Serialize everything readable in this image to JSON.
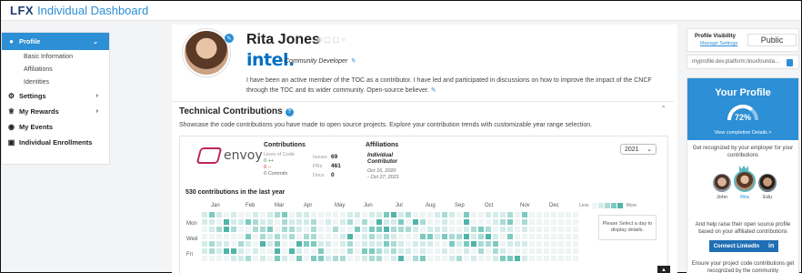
{
  "header": {
    "logo": "LFX",
    "logo_letters_accent": "LF",
    "title": "Individual Dashboard"
  },
  "sidebar": {
    "items": [
      {
        "label": "Profile",
        "icon": "person-icon",
        "active": true
      },
      {
        "label": "Settings",
        "icon": "gear-icon"
      },
      {
        "label": "My Rewards",
        "icon": "trophy-icon"
      },
      {
        "label": "My Events",
        "icon": "circle-icon"
      },
      {
        "label": "Individual Enrollments",
        "icon": "document-icon"
      }
    ],
    "sub_items": [
      "Basic Information",
      "Affiliations",
      "Identities"
    ]
  },
  "profile": {
    "name": "Rita Jones",
    "company": "intel.",
    "role": "Community Developer",
    "bio": "I have been an active member of the TOC as a contributor. I have led and participated in discussions on how to improve the impact of the CNCF through the TOC and its wider community. Open-source believer."
  },
  "technical": {
    "title": "Technical Contributions",
    "description": "Showcase the code contributions you have made to open source projects. Explore your contribution trends with customizable year range selection.",
    "year": "2021",
    "project": "envoy",
    "contributions": {
      "title": "Contributions",
      "lines_label": "Lines of Code",
      "lines_added": "0 ++",
      "lines_removed": "0 --",
      "commits": "0 Commits",
      "issues_label": "Issues",
      "issues": "69",
      "prs_label": "PRs",
      "prs": "461",
      "docs_label": "Docs",
      "docs": "0"
    },
    "affiliations": {
      "title": "Affiliations",
      "type_line1": "Individual",
      "type_line2": "Contributor",
      "date_line1": "Oct 16, 2020",
      "date_line2": "- Oct 27, 2021"
    },
    "calendar_title": "530 contributions in the last year",
    "months": [
      "Jan",
      "Feb",
      "Mar",
      "Apr",
      "May",
      "Jun",
      "Jul",
      "Aug",
      "Sep",
      "Oct",
      "Nov",
      "Dec"
    ],
    "days": [
      "Mon",
      "Wed",
      "Fri"
    ],
    "legend_less": "Less",
    "legend_more": "More",
    "detail_text": "Please Select a day to display details.",
    "heat_colors": [
      "#eef5f4",
      "#d3ece8",
      "#a9dbd4",
      "#7ccabf",
      "#4fb5a8"
    ]
  },
  "right_panel": {
    "visibility_title": "Profile Visibility",
    "manage_settings": "Manage Settings",
    "visibility_value": "Public",
    "profile_url": "myprofile.dev.platform.linuxfounda...",
    "your_profile": "Your Profile",
    "completion": 72,
    "completion_label": "72%",
    "completion_link": "View completion Details >",
    "recognized_text": "Get recognized by your employer for your contributions",
    "people": [
      "John",
      "Rita",
      "Edu"
    ],
    "raise_text": "And help raise their open source profile based on your affiliated contributions",
    "linkedin_button": "Connect LinkedIn",
    "linkedin_icon": "in",
    "ensure_text": "Ensure your project code contributions get recognized by the community",
    "accent_color": "#2d8fd5"
  }
}
